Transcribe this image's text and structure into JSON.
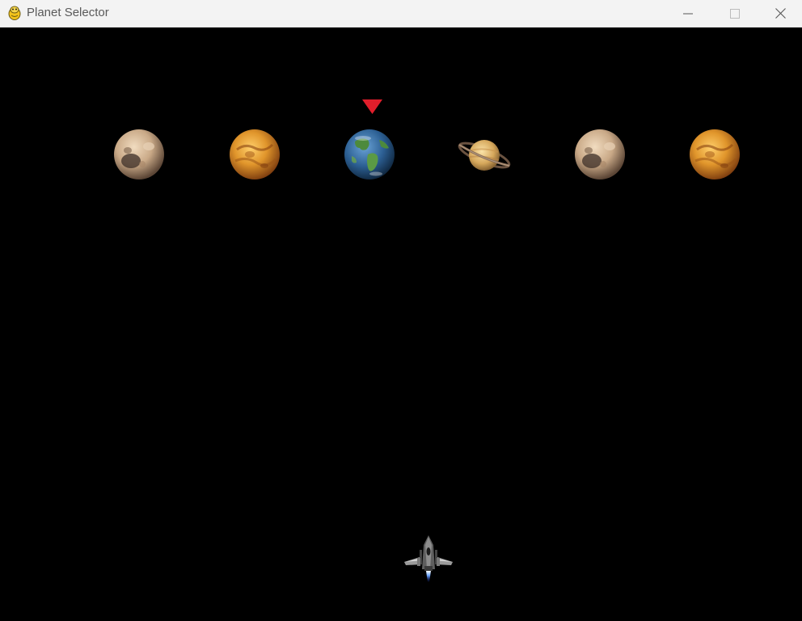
{
  "window": {
    "title": "Planet Selector",
    "app_icon": "pygame-snake-icon",
    "controls": [
      "minimize-icon",
      "maximize-icon",
      "close-icon"
    ]
  },
  "game": {
    "background_color": "#000000",
    "selector_color": "#e01e2b",
    "selected_index": 2,
    "planets": [
      {
        "kind": "pluto"
      },
      {
        "kind": "venus"
      },
      {
        "kind": "earth"
      },
      {
        "kind": "saturn"
      },
      {
        "kind": "pluto"
      },
      {
        "kind": "venus"
      }
    ],
    "ship": {
      "kind": "spaceship-icon"
    }
  }
}
